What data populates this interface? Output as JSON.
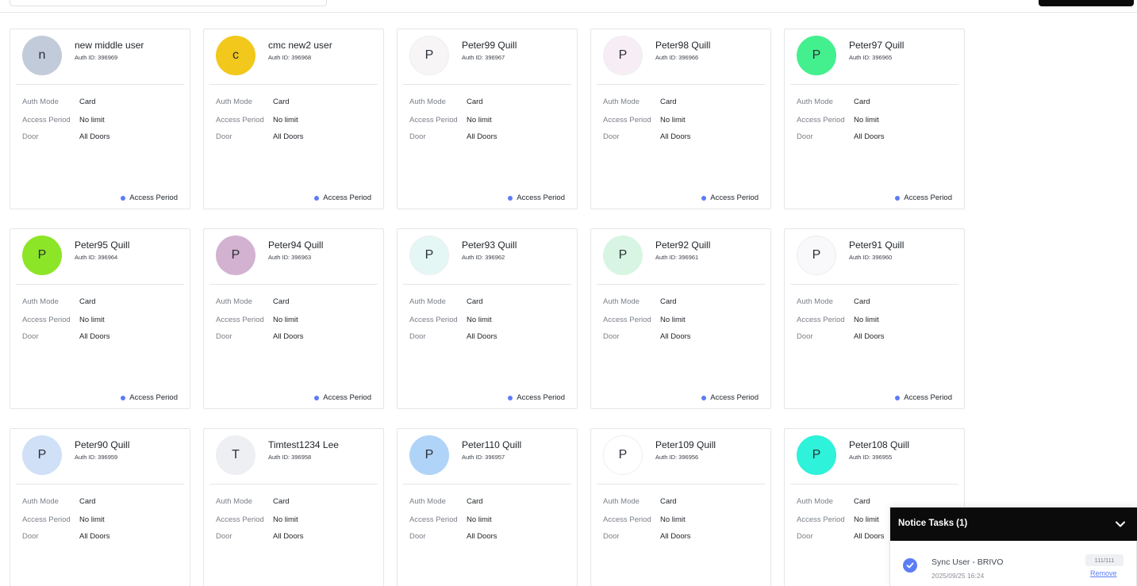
{
  "labels": {
    "auth_mode": "Auth Mode",
    "access_period": "Access Period",
    "door": "Door",
    "auth_id_prefix": "Auth ID: "
  },
  "users": [
    {
      "initial": "n",
      "name": "new middle user",
      "auth_id": "Auth ID: 396969",
      "auth_mode": "Card",
      "access_period": "No limit",
      "door": "All Doors",
      "tag": "Access Period",
      "avatar_color": "#c2cbd9"
    },
    {
      "initial": "c",
      "name": "cmc new2 user",
      "auth_id": "Auth ID: 396968",
      "auth_mode": "Card",
      "access_period": "No limit",
      "door": "All Doors",
      "tag": "Access Period",
      "avatar_color": "#f1c81b"
    },
    {
      "initial": "P",
      "name": "Peter99 Quill",
      "auth_id": "Auth ID: 396967",
      "auth_mode": "Card",
      "access_period": "No limit",
      "door": "All Doors",
      "tag": "Access Period",
      "avatar_color": "#f7f5f6"
    },
    {
      "initial": "P",
      "name": "Peter98 Quill",
      "auth_id": "Auth ID: 396966",
      "auth_mode": "Card",
      "access_period": "No limit",
      "door": "All Doors",
      "tag": "Access Period",
      "avatar_color": "#f7eef5"
    },
    {
      "initial": "P",
      "name": "Peter97 Quill",
      "auth_id": "Auth ID: 396965",
      "auth_mode": "Card",
      "access_period": "No limit",
      "door": "All Doors",
      "tag": "Access Period",
      "avatar_color": "#44f08e"
    },
    {
      "initial": "P",
      "name": "Peter95 Quill",
      "auth_id": "Auth ID: 396964",
      "auth_mode": "Card",
      "access_period": "No limit",
      "door": "All Doors",
      "tag": "Access Period",
      "avatar_color": "#8de527"
    },
    {
      "initial": "P",
      "name": "Peter94 Quill",
      "auth_id": "Auth ID: 396963",
      "auth_mode": "Card",
      "access_period": "No limit",
      "door": "All Doors",
      "tag": "Access Period",
      "avatar_color": "#d2b1d1"
    },
    {
      "initial": "P",
      "name": "Peter93 Quill",
      "auth_id": "Auth ID: 396962",
      "auth_mode": "Card",
      "access_period": "No limit",
      "door": "All Doors",
      "tag": "Access Period",
      "avatar_color": "#e4f7f5"
    },
    {
      "initial": "P",
      "name": "Peter92 Quill",
      "auth_id": "Auth ID: 396961",
      "auth_mode": "Card",
      "access_period": "No limit",
      "door": "All Doors",
      "tag": "Access Period",
      "avatar_color": "#d8f5e3"
    },
    {
      "initial": "P",
      "name": "Peter91 Quill",
      "auth_id": "Auth ID: 396960",
      "auth_mode": "Card",
      "access_period": "No limit",
      "door": "All Doors",
      "tag": "Access Period",
      "avatar_color": "#f9f8fb"
    },
    {
      "initial": "P",
      "name": "Peter90 Quill",
      "auth_id": "Auth ID: 396959",
      "auth_mode": "Card",
      "access_period": "No limit",
      "door": "All Doors",
      "tag": "Access Period",
      "avatar_color": "#cfe0f7"
    },
    {
      "initial": "T",
      "name": "Timtest1234 Lee",
      "auth_id": "Auth ID: 396958",
      "auth_mode": "Card",
      "access_period": "No limit",
      "door": "All Doors",
      "tag": "Access Period",
      "avatar_color": "#eeeff3"
    },
    {
      "initial": "P",
      "name": "Peter110 Quill",
      "auth_id": "Auth ID: 396957",
      "auth_mode": "Card",
      "access_period": "No limit",
      "door": "All Doors",
      "tag": "Access Period",
      "avatar_color": "#b0d3f8"
    },
    {
      "initial": "P",
      "name": "Peter109 Quill",
      "auth_id": "Auth ID: 396956",
      "auth_mode": "Card",
      "access_period": "No limit",
      "door": "All Doors",
      "tag": "Access Period",
      "avatar_color": "#ffffff"
    },
    {
      "initial": "P",
      "name": "Peter108 Quill",
      "auth_id": "Auth ID: 396955",
      "auth_mode": "Card",
      "access_period": "No limit",
      "door": "All Doors",
      "tag": "Access Period",
      "avatar_color": "#2ef2d9"
    }
  ],
  "notice": {
    "title": "Notice Tasks",
    "count": "(1)",
    "task": {
      "name": "Sync User - BRIVO",
      "time": "2025/09/25 16:24",
      "progress": "111/111",
      "remove_label": "Remove",
      "status_icon": "check-circle-icon"
    },
    "accent_color": "#5b7cf6"
  }
}
